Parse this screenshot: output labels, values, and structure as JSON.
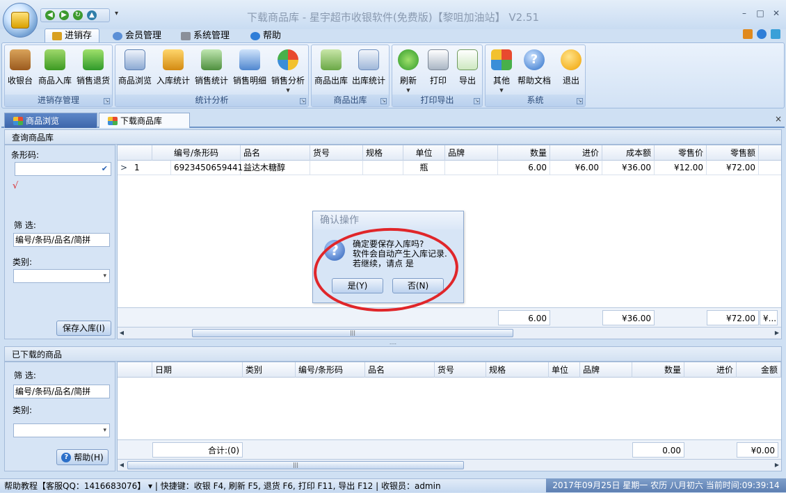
{
  "window": {
    "title": "下载商品库 - 星宇超市收银软件(免费版)【黎咀加油站】 V2.51",
    "controls": {
      "minimize": "–",
      "maximize": "□",
      "close": "✕"
    }
  },
  "qat": {
    "more": "▾"
  },
  "ribbon_tabs": [
    {
      "label": "进销存",
      "active": true
    },
    {
      "label": "会员管理",
      "active": false
    },
    {
      "label": "系统管理",
      "active": false
    },
    {
      "label": "帮助",
      "active": false
    }
  ],
  "ribbon_groups": [
    {
      "label": "进销存管理",
      "buttons": [
        "收银台",
        "商品入库",
        "销售退货"
      ]
    },
    {
      "label": "统计分析",
      "buttons": [
        "商品浏览",
        "入库统计",
        "销售统计",
        "销售明细",
        "销售分析"
      ]
    },
    {
      "label": "商品出库",
      "buttons": [
        "商品出库",
        "出库统计"
      ]
    },
    {
      "label": "打印导出",
      "buttons": [
        "刷新",
        "打印",
        "导出"
      ]
    },
    {
      "label": "系统",
      "buttons": [
        "其他",
        "帮助文档",
        "退出"
      ]
    }
  ],
  "doc_tabs": [
    {
      "label": "商品浏览"
    },
    {
      "label": "下载商品库"
    }
  ],
  "doc_close": "×",
  "top_panel": {
    "header": "查询商品库",
    "barcode_label": "条形码:",
    "check_mark": "√",
    "filter_label": "筛    选:",
    "filter_value": "编号/条码/品名/简拼",
    "category_label": "类别:",
    "save_button": "保存入库(I)",
    "grid": {
      "columns": [
        "",
        "编号/条形码",
        "品名",
        "货号",
        "规格",
        "单位",
        "品牌",
        "数量",
        "进价",
        "成本额",
        "零售价",
        "零售额"
      ],
      "rows": [
        {
          "indicator": ">",
          "no": "1",
          "code": "6923450659441",
          "name": "益达木糖醇",
          "item_no": "",
          "spec": "",
          "unit": "瓶",
          "brand": "",
          "qty": "6.00",
          "cost_price": "¥6.00",
          "cost_total": "¥36.00",
          "retail_price": "¥12.00",
          "retail_total": "¥72.00"
        }
      ],
      "footer": {
        "qty": "6.00",
        "cost_total": "¥36.00",
        "retail_total": "¥72.00",
        "extra": "¥..."
      }
    }
  },
  "splitter": "....",
  "bottom_panel": {
    "header": "已下载的商品",
    "filter_label": "筛    选:",
    "filter_value": "编号/条码/品名/简拼",
    "category_label": "类别:",
    "help_button": "帮助(H)",
    "grid": {
      "columns": [
        "日期",
        "类别",
        "编号/条形码",
        "品名",
        "货号",
        "规格",
        "单位",
        "品牌",
        "数量",
        "进价",
        "金额"
      ],
      "footer": {
        "total": "合计:(0)",
        "qty": "0.00",
        "amount": "¥0.00"
      }
    }
  },
  "dialog": {
    "title": "确认操作",
    "line1": "确定要保存入库吗?",
    "line2": "软件会自动产生入库记录.",
    "line3": "若继续，请点 是",
    "yes": "是(Y)",
    "no": "否(N)"
  },
  "statusbar": {
    "left": "帮助教程【客服QQ：1416683076】 ▾ | 快捷键：收银 F4, 刷新 F5, 退货 F6, 打印 F11, 导出 F12 | 收银员：admin",
    "right": "2017年09月25日 星期一 农历 八月初六 当前时间:09:39:14"
  },
  "colors": {
    "accent": "#3d66aa",
    "ellipse": "#e0262a"
  }
}
